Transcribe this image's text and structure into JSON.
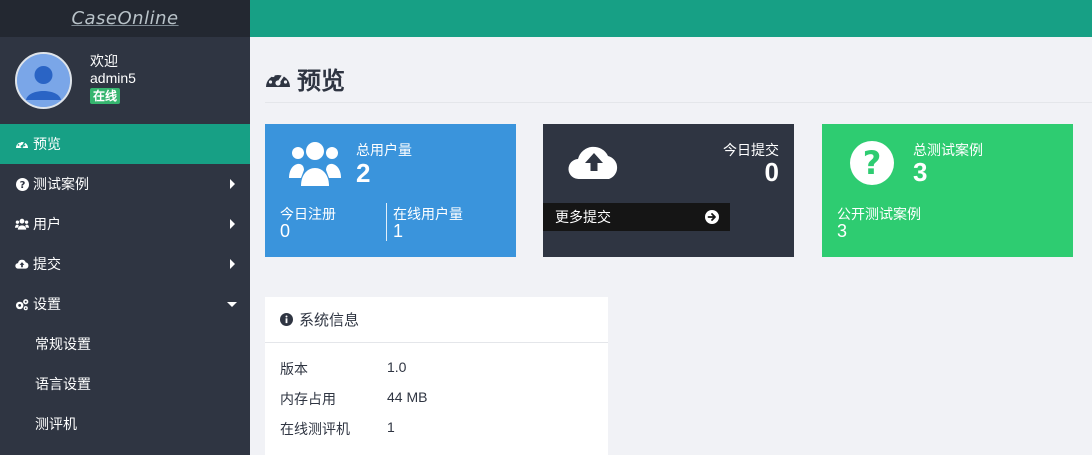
{
  "app": {
    "logo_text": "CaseOnline"
  },
  "user": {
    "welcome": "欢迎",
    "name": "admin5",
    "status": "在线"
  },
  "sidebar": {
    "items": [
      {
        "label": "预览",
        "icon": "dashboard-icon",
        "active": true
      },
      {
        "label": "测试案例",
        "icon": "question-icon"
      },
      {
        "label": "用户",
        "icon": "users-icon"
      },
      {
        "label": "提交",
        "icon": "cloud-upload-icon"
      },
      {
        "label": "设置",
        "icon": "gears-icon",
        "expanded": true
      }
    ],
    "sub_items": [
      {
        "label": "常规设置"
      },
      {
        "label": "语言设置"
      },
      {
        "label": "测评机"
      }
    ]
  },
  "page": {
    "title": "预览"
  },
  "cards": {
    "users": {
      "label": "总用户量",
      "value": "2",
      "today_label": "今日注册",
      "today_value": "0",
      "online_label": "在线用户量",
      "online_value": "1",
      "color": "#3a94dc"
    },
    "submissions": {
      "label": "今日提交",
      "value": "0",
      "more_label": "更多提交",
      "color": "#2f3542"
    },
    "testcases": {
      "label": "总测试案例",
      "value": "3",
      "public_label": "公开测试案例",
      "public_value": "3",
      "color": "#2ecc71"
    }
  },
  "system_info": {
    "title": "系统信息",
    "rows": [
      {
        "label": "版本",
        "value": "1.0"
      },
      {
        "label": "内存占用",
        "value": "44 MB"
      },
      {
        "label": "在线测评机",
        "value": "1"
      }
    ]
  },
  "colors": {
    "accent": "#17a085",
    "sidebar": "#2f3542",
    "logo_bar": "#232831"
  }
}
